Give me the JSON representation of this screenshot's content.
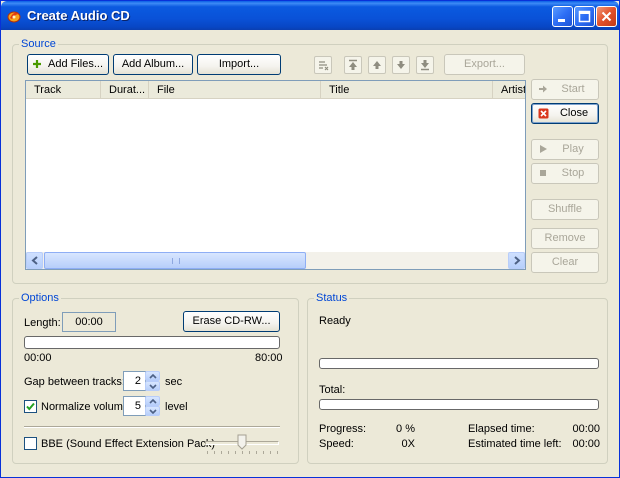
{
  "window": {
    "title": "Create Audio CD"
  },
  "source": {
    "legend": "Source",
    "add_files": "Add Files...",
    "add_album": "Add Album...",
    "import": "Import...",
    "export": "Export...",
    "columns": [
      "Track",
      "Durat...",
      "File",
      "Title",
      "Artist"
    ],
    "rows": []
  },
  "side_buttons": {
    "start": "Start",
    "close": "Close",
    "play": "Play",
    "stop": "Stop",
    "shuffle": "Shuffle",
    "remove": "Remove",
    "clear": "Clear"
  },
  "options": {
    "legend": "Options",
    "length_label": "Length:",
    "length_value": "00:00",
    "erase_button": "Erase CD-RW...",
    "capacity_fill": 0,
    "capacity_min": "00:00",
    "capacity_max": "80:00",
    "gap_label": "Gap between tracks:",
    "gap_value": "2",
    "gap_unit": "sec",
    "normalize_label": "Normalize volume:",
    "normalize_checked": true,
    "normalize_value": "5",
    "normalize_unit": "level",
    "bbe_label": "BBE (Sound Effect Extension Pack)",
    "bbe_checked": false,
    "bbe_level": 0.5
  },
  "status": {
    "legend": "Status",
    "state": "Ready",
    "track_progress": 0,
    "total_label": "Total:",
    "total_progress": 0,
    "progress_label": "Progress:",
    "progress_value": "0 %",
    "speed_label": "Speed:",
    "speed_value": "0X",
    "elapsed_label": "Elapsed time:",
    "elapsed_value": "00:00",
    "remaining_label": "Estimated time left:",
    "remaining_value": "00:00"
  },
  "colors": {
    "titlebar": "#0a52d8",
    "accent": "#0046d5",
    "close_red": "#e2502a"
  },
  "icons": [
    "app-flame-icon",
    "minimize-icon",
    "maximize-icon",
    "close-icon",
    "add-files-plus-icon",
    "clear-list-icon",
    "move-top-icon",
    "move-up-icon",
    "move-down-icon",
    "move-bottom-icon",
    "start-arrow-icon",
    "close-x-icon",
    "play-icon",
    "stop-icon",
    "checkmark-icon"
  ]
}
